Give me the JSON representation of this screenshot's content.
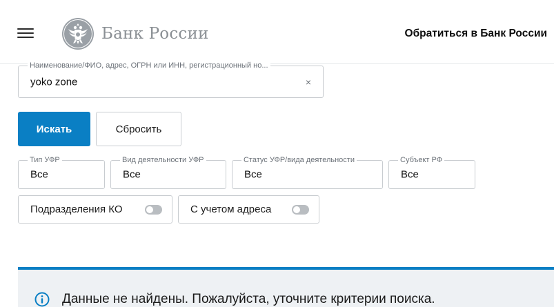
{
  "header": {
    "logo_text": "Банк России",
    "contact_link": "Обратиться в Банк России"
  },
  "search": {
    "label": "Наименование/ФИО, адрес, ОГРН или ИНН, регистрационный но...",
    "value": "yoko zone",
    "clear_symbol": "×"
  },
  "buttons": {
    "search": "Искать",
    "reset": "Сбросить"
  },
  "filters": [
    {
      "label": "Тип УФР",
      "value": "Все"
    },
    {
      "label": "Вид деятельности УФР",
      "value": "Все"
    },
    {
      "label": "Статус УФР/вида деятельности",
      "value": "Все"
    },
    {
      "label": "Субъект РФ",
      "value": "Все"
    }
  ],
  "toggles": [
    {
      "label": "Подразделения КО",
      "on": false
    },
    {
      "label": "С учетом адреса",
      "on": false
    }
  ],
  "notice": {
    "text": "Данные не найдены. Пожалуйста, уточните критерии поиска."
  },
  "colors": {
    "accent": "#0a7fc4",
    "notice_bg": "#eef1f4",
    "border": "#c8ccd0"
  }
}
